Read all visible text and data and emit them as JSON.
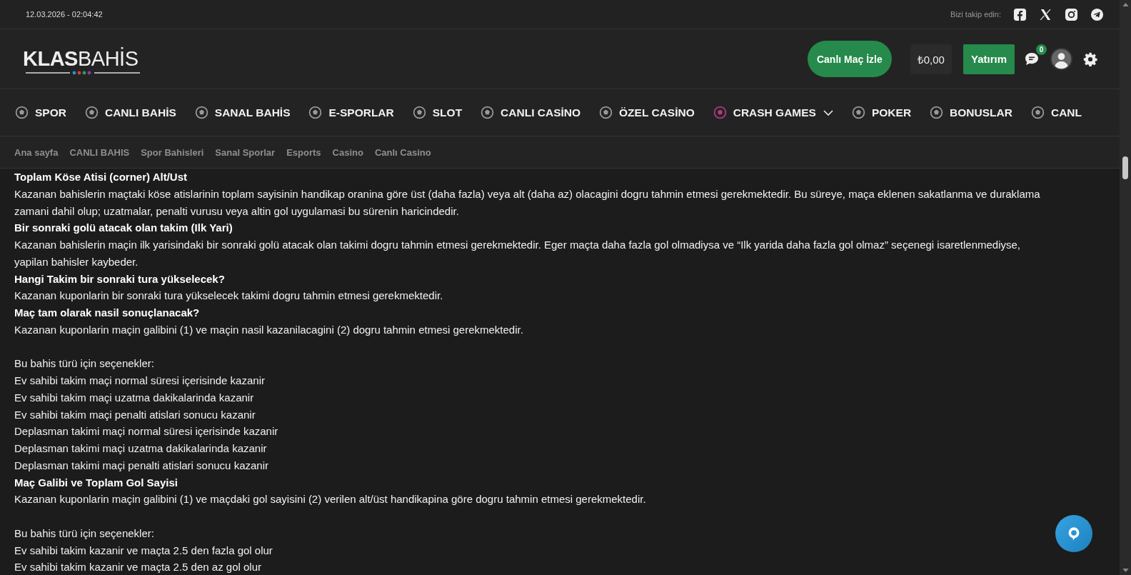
{
  "top_bar": {
    "datetime": "12.03.2026 - 02:04:42",
    "follow_label": "Bizi takip edin:"
  },
  "header": {
    "logo": {
      "bold": "KLAS",
      "light": "BAHİS"
    },
    "live_button": "Canlı Maç İzle",
    "balance": "₺0,00",
    "deposit_button": "Yatırım",
    "messages_badge": "0"
  },
  "nav": [
    {
      "label": "SPOR",
      "dropdown": false
    },
    {
      "label": "CANLI BAHİS",
      "dropdown": false
    },
    {
      "label": "SANAL BAHİS",
      "dropdown": false
    },
    {
      "label": "E-SPORLAR",
      "dropdown": false
    },
    {
      "label": "SLOT",
      "dropdown": false
    },
    {
      "label": "CANLI CASİNO",
      "dropdown": false
    },
    {
      "label": "ÖZEL CASİNO",
      "dropdown": false
    },
    {
      "label": "CRASH GAMES",
      "dropdown": true
    },
    {
      "label": "POKER",
      "dropdown": false
    },
    {
      "label": "BONUSLAR",
      "dropdown": false
    },
    {
      "label": "CANL",
      "dropdown": false
    }
  ],
  "breadcrumbs": [
    "Ana sayfa",
    "CANLI BAHIS",
    "Spor Bahisleri",
    "Sanal Sporlar",
    "Esports",
    "Casino",
    "Canlı Casino"
  ],
  "content": [
    {
      "kind": "heading",
      "text": "Toplam Köse Atisi (corner) Alt/Ust"
    },
    {
      "kind": "paragraph",
      "text": "Kazanan bahislerin maçtaki köse atislarinin toplam sayisinin handikap oranina göre üst (daha fazla) veya alt (daha az) olacagini dogru tahmin etmesi gerekmektedir. Bu süreye, maça eklenen sakatlanma ve duraklama zamani dahil olup; uzatmalar, penalti vurusu veya altin gol uygulamasi bu sürenin haricindedir."
    },
    {
      "kind": "heading",
      "text": "Bir sonraki golü atacak olan takim (Ilk Yari)"
    },
    {
      "kind": "paragraph",
      "text": "Kazanan bahislerin maçin ilk yarisindaki bir sonraki golü atacak olan takimi dogru tahmin etmesi gerekmektedir. Eger maçta daha fazla gol olmadiysa ve “Ilk yarida daha fazla gol olmaz” seçenegi isaretlenmediyse, yapilan bahisler kaybeder."
    },
    {
      "kind": "heading",
      "text": "Hangi Takim bir sonraki tura yükselecek?"
    },
    {
      "kind": "paragraph",
      "text": "Kazanan kuponlarin bir sonraki tura yükselecek takimi dogru tahmin etmesi gerekmektedir."
    },
    {
      "kind": "heading",
      "text": "Maç tam olarak nasil sonuçlanacak?"
    },
    {
      "kind": "paragraph",
      "text": "Kazanan kuponlarin maçin galibini (1) ve maçin nasil kazanilacagini (2) dogru tahmin etmesi gerekmektedir."
    },
    {
      "kind": "gap"
    },
    {
      "kind": "paragraph",
      "text": "Bu bahis türü için seçenekler:"
    },
    {
      "kind": "paragraph",
      "text": "Ev sahibi takim maçi normal süresi içerisinde kazanir"
    },
    {
      "kind": "paragraph",
      "text": "Ev sahibi takim maçi uzatma dakikalarinda kazanir"
    },
    {
      "kind": "paragraph",
      "text": "Ev sahibi takim maçi penalti atislari sonucu kazanir"
    },
    {
      "kind": "paragraph",
      "text": "Deplasman takimi maçi normal süresi içerisinde kazanir"
    },
    {
      "kind": "paragraph",
      "text": "Deplasman takimi maçi uzatma dakikalarinda kazanir"
    },
    {
      "kind": "paragraph",
      "text": "Deplasman takimi maçi penalti atislari sonucu kazanir"
    },
    {
      "kind": "heading",
      "text": "Maç Galibi ve Toplam Gol Sayisi"
    },
    {
      "kind": "paragraph",
      "text": "Kazanan kuponlarin maçin galibini (1) ve maçdaki gol sayisini (2) verilen alt/üst handikapina göre dogru tahmin etmesi gerekmektedir."
    },
    {
      "kind": "gap"
    },
    {
      "kind": "paragraph",
      "text": "Bu bahis türü için seçenekler:"
    },
    {
      "kind": "paragraph",
      "text": "Ev sahibi takim kazanir ve maçta 2.5 den fazla gol olur"
    },
    {
      "kind": "paragraph",
      "text": "Ev sahibi takim kazanir ve maçta 2.5 den az gol olur"
    }
  ]
}
